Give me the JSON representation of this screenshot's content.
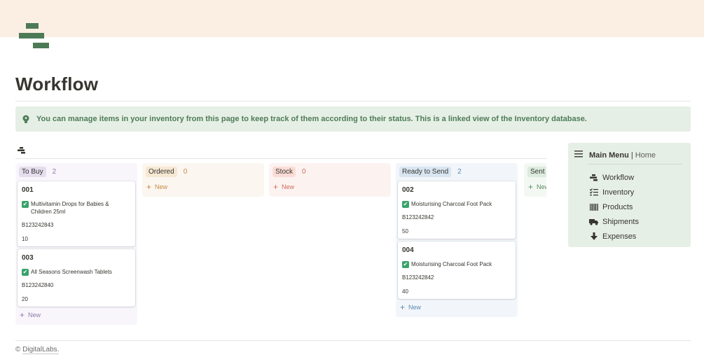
{
  "page": {
    "title": "Workflow",
    "callout": "You can manage items in your inventory from this page to keep track of them according to their status. This is a linked view of the Inventory database."
  },
  "colors": {
    "cover": "#fbeee2",
    "accent_green": "#4d7a56",
    "callout_bg": "#e6efe6"
  },
  "board": {
    "columns": [
      {
        "name": "To Buy",
        "count": "2",
        "tag_bg": "#e6ddee",
        "col_bg": "#f8f6fb",
        "count_color": "#8e7aa8",
        "cards": [
          {
            "title": "001",
            "product": "Multivitamin Drops for Babies & Children 25ml",
            "sku": "B123242843",
            "qty": "10"
          },
          {
            "title": "003",
            "product": "All Seasons Screenwash Tablets",
            "sku": "B123242840",
            "qty": "20"
          }
        ],
        "new_label": "New"
      },
      {
        "name": "Ordered",
        "count": "0",
        "tag_bg": "#f6e7d3",
        "col_bg": "#fbf6ef",
        "count_color": "#c38b45",
        "cards": [],
        "new_label": "New"
      },
      {
        "name": "Stock",
        "count": "0",
        "tag_bg": "#fadcd6",
        "col_bg": "#fcf3f1",
        "count_color": "#cf6c5a",
        "cards": [],
        "new_label": "New"
      },
      {
        "name": "Ready to Send",
        "count": "2",
        "tag_bg": "#d9e6f2",
        "col_bg": "#f2f6fa",
        "count_color": "#5a89b3",
        "cards": [
          {
            "title": "002",
            "product": "Moisturising Charcoal Foot Pack",
            "sku": "B123242842",
            "qty": "50"
          },
          {
            "title": "004",
            "product": "Moisturising Charcoal Foot Pack",
            "sku": "B123242842",
            "qty": "40"
          }
        ],
        "new_label": "New"
      },
      {
        "name": "Sent to",
        "count": "",
        "tag_bg": "#dcebdc",
        "col_bg": "#f3f8f3",
        "count_color": "#5b8c5f",
        "cards": [],
        "new_label": "New"
      }
    ]
  },
  "menu": {
    "title": "Main Menu",
    "separator": "|",
    "home": "Home",
    "items": [
      {
        "label": "Workflow",
        "icon": "workflow-icon"
      },
      {
        "label": "Inventory",
        "icon": "checklist-icon"
      },
      {
        "label": "Products",
        "icon": "barcode-icon"
      },
      {
        "label": "Shipments",
        "icon": "truck-icon"
      },
      {
        "label": "Expenses",
        "icon": "arrow-down-icon"
      }
    ]
  },
  "footer": {
    "copyright": "©",
    "brand": "DigitalLabs."
  }
}
